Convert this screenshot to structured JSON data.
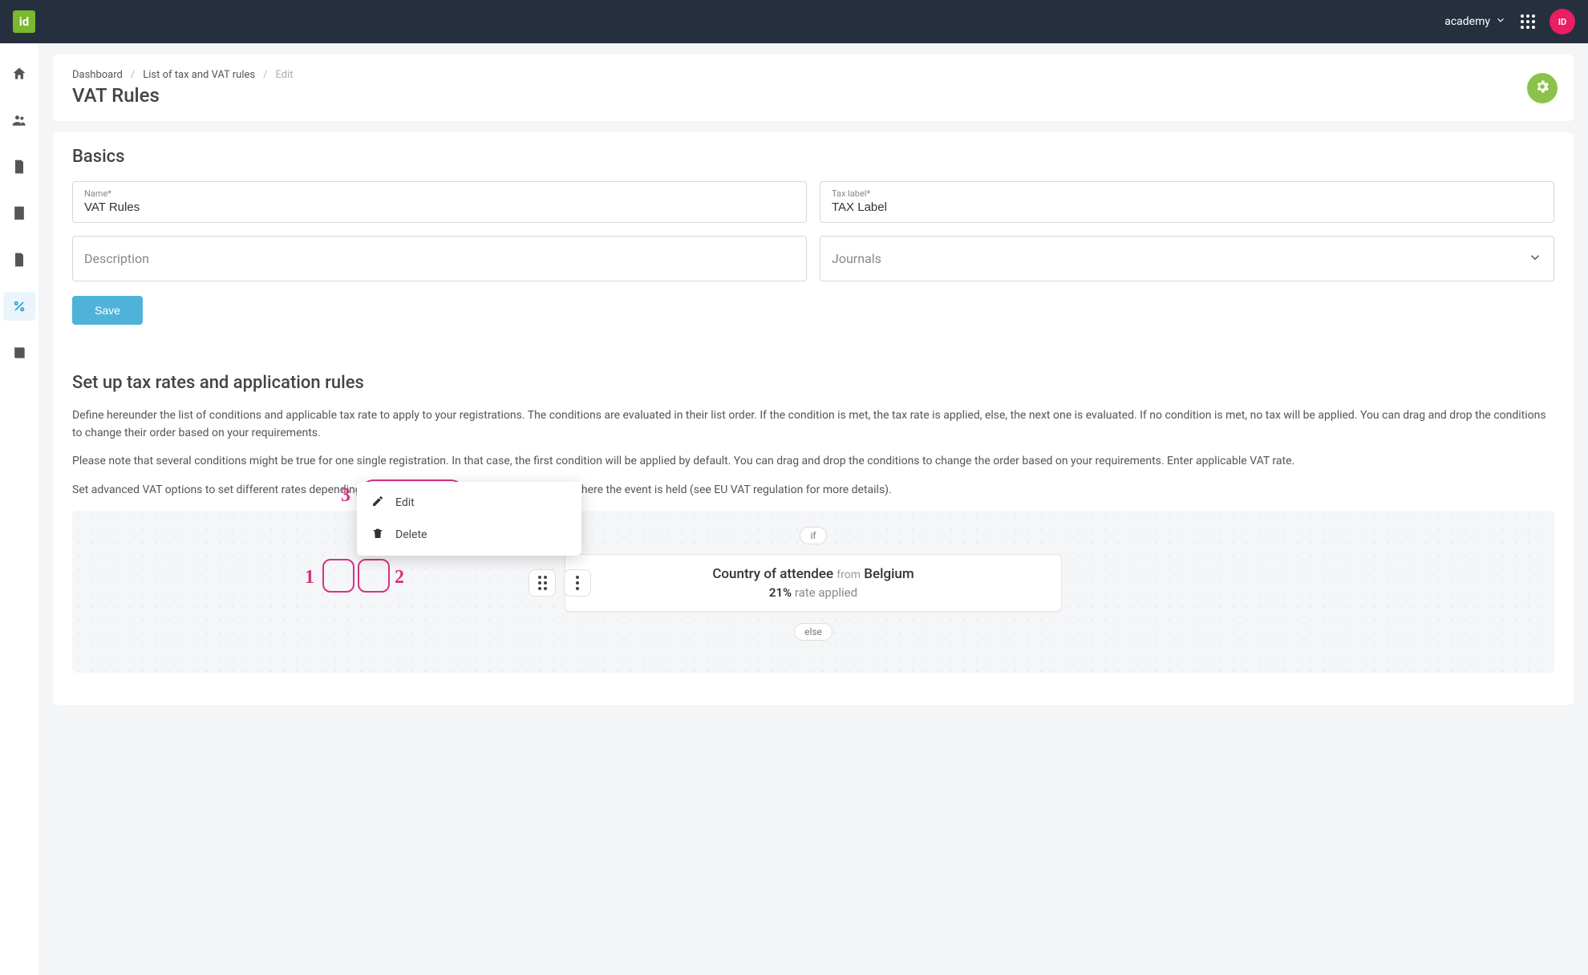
{
  "header": {
    "logo_text": "id",
    "account_label": "academy",
    "avatar_text": "ID"
  },
  "breadcrumb": {
    "items": [
      "Dashboard",
      "List of tax and VAT rules",
      "Edit"
    ]
  },
  "page_title": "VAT Rules",
  "basics": {
    "heading": "Basics",
    "name_label": "Name*",
    "name_value": "VAT Rules",
    "taxlabel_label": "Tax label*",
    "taxlabel_value": "TAX Label",
    "description_placeholder": "Description",
    "journals_placeholder": "Journals",
    "save_label": "Save"
  },
  "rules": {
    "heading": "Set up tax rates and application rules",
    "para1": "Define hereunder the list of conditions and applicable tax rate to apply to your registrations. The conditions are evaluated in their list order. If the condition is met, the tax rate is applied, else, the next one is evaluated. If no condition is met, no tax will be applied. You can drag and drop the conditions to change their order based on your requirements.",
    "para2": "Please note that several conditions might be true for one single registration. In that case, the first condition will be applied by default. You can drag and drop the conditions to change the order based on your requirements. Enter applicable VAT rate.",
    "para3": "Set advanced VAT options to set different rates depending of the registrants country and the country where the event is held (see EU VAT regulation for more details).",
    "pill_if": "if",
    "pill_else": "else",
    "rule_condition_prefix": "Country of attendee",
    "rule_condition_mid": "from",
    "rule_condition_country": "Belgium",
    "rule_rate_value": "21%",
    "rule_rate_suffix": "rate applied"
  },
  "popup": {
    "edit": "Edit",
    "delete": "Delete"
  },
  "callouts": {
    "c1": "1",
    "c2": "2",
    "c3": "3"
  }
}
